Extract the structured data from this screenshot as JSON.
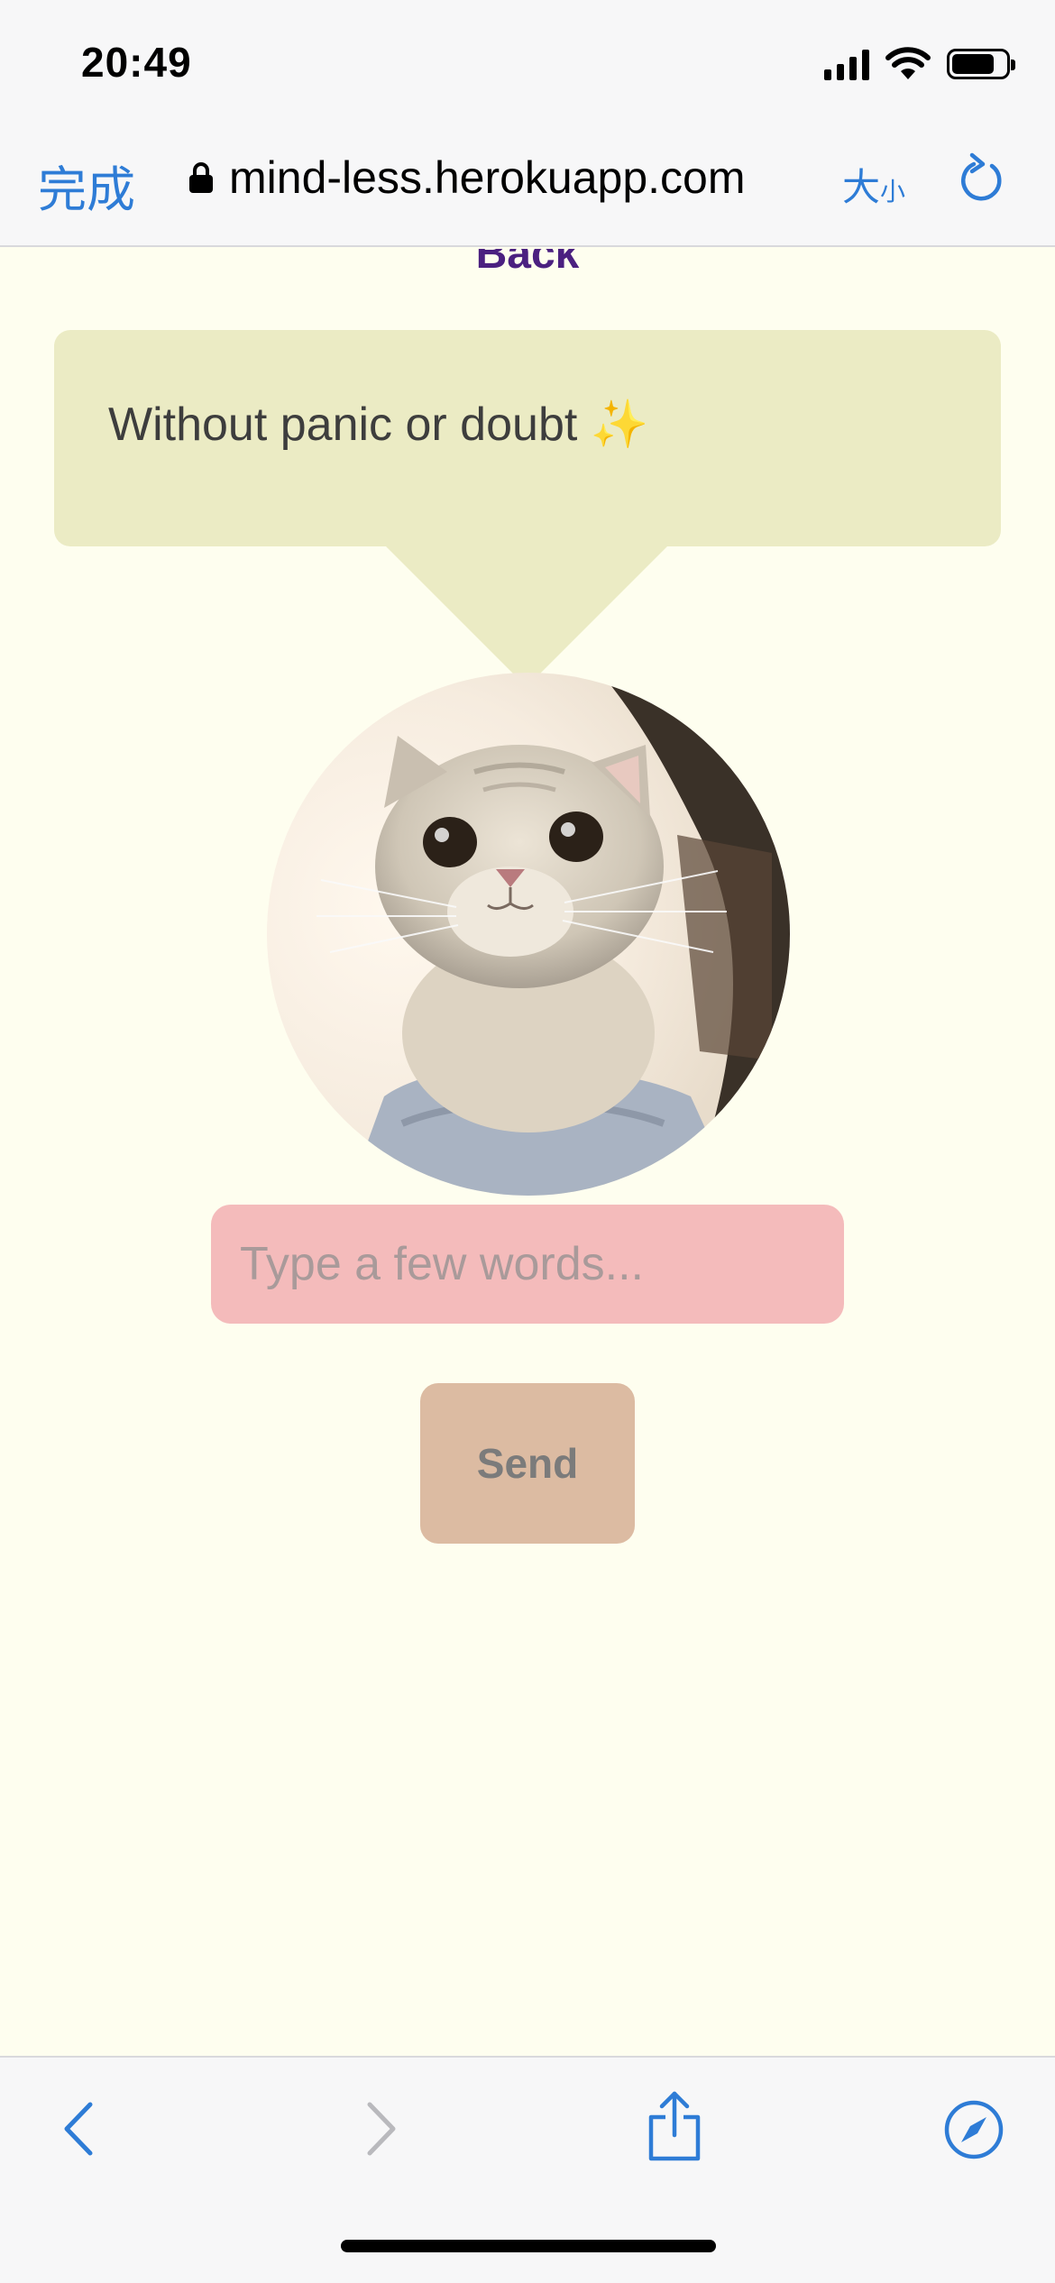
{
  "status_bar": {
    "time": "20:49"
  },
  "browser": {
    "done_label": "完成",
    "url": "mind-less.herokuapp.com",
    "text_size_big": "大",
    "text_size_small": "小"
  },
  "page": {
    "back_label": "Back",
    "bubble_text": "Without panic or doubt ✨",
    "input_placeholder": "Type a few words...",
    "input_value": "",
    "send_label": "Send"
  },
  "colors": {
    "background": "#fefeef",
    "bubble": "#ebebc4",
    "input": "#f4bbbb",
    "send_button": "#dcbba2",
    "link": "#4b2080",
    "accent": "#2e7cd6"
  }
}
